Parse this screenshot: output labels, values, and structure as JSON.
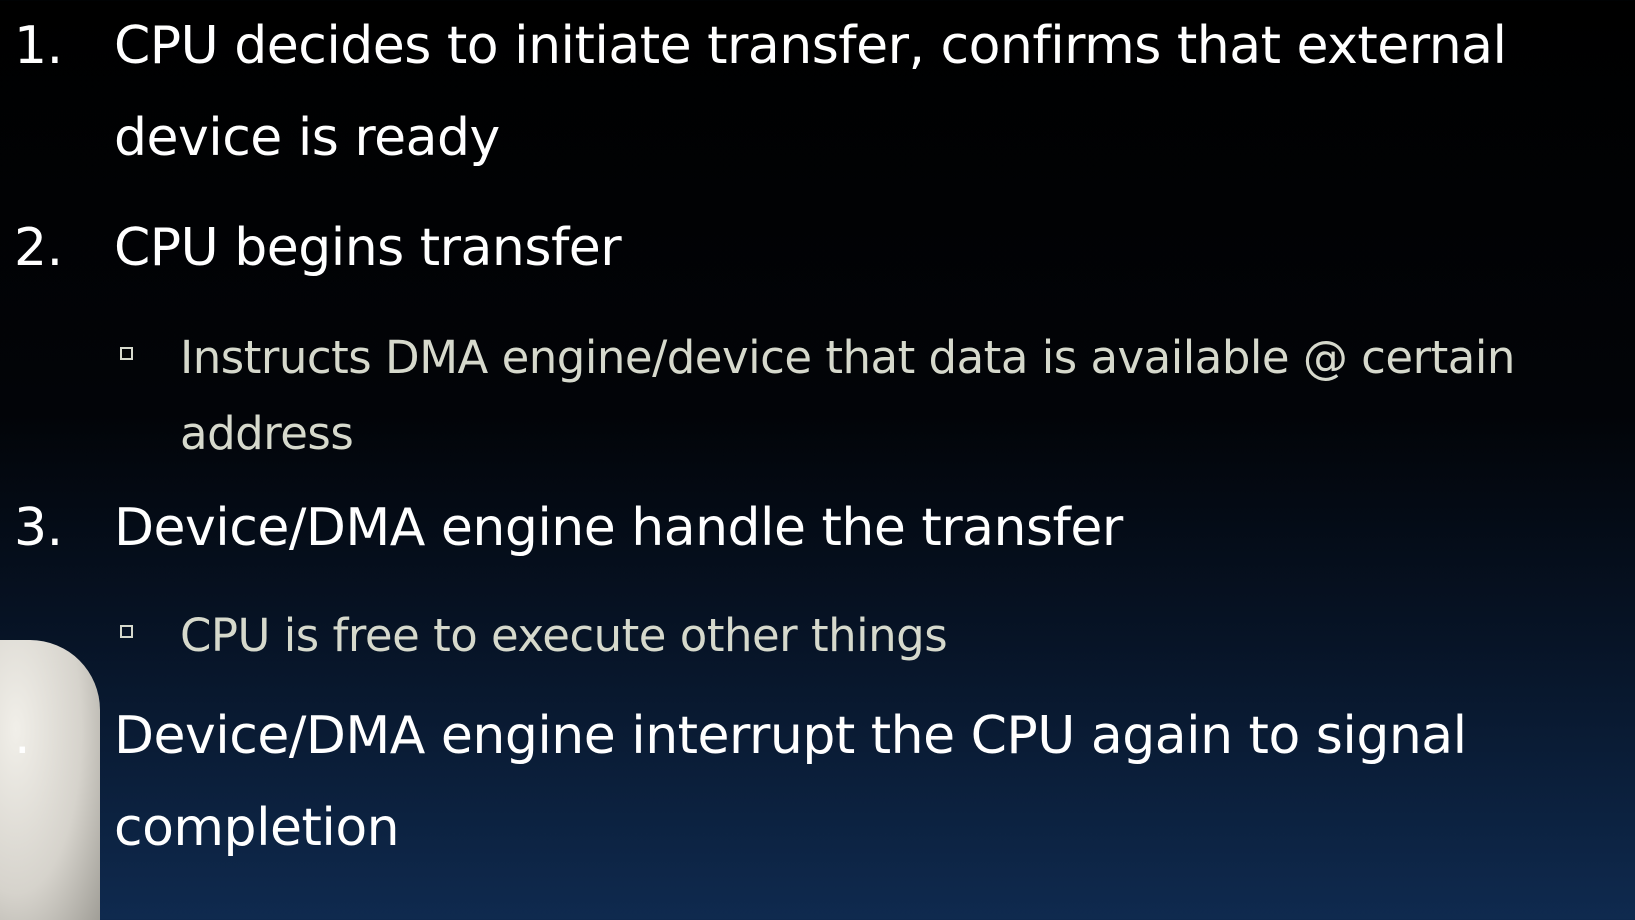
{
  "slide": {
    "items": [
      {
        "number": "1.",
        "text": "CPU decides to initiate transfer, confirms that external device is ready"
      },
      {
        "number": "2.",
        "text": "CPU begins transfer",
        "sub": "Instructs DMA engine/device that data is available @ certain address"
      },
      {
        "number": "3.",
        "text": "Device/DMA engine handle the transfer",
        "sub": "CPU is free to execute other things"
      },
      {
        "number": ".",
        "text": "Device/DMA engine interrupt the CPU again to signal completion"
      }
    ]
  }
}
